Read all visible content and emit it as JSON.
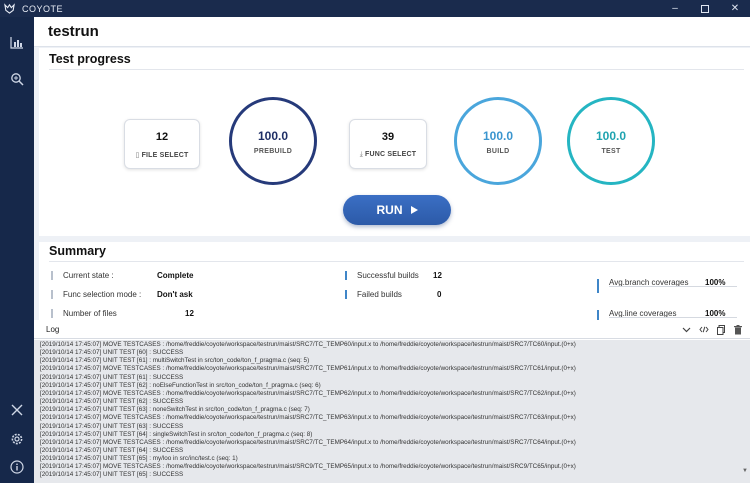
{
  "window": {
    "app_title": "COYOTE",
    "controls": [
      "minimize-icon",
      "maximize-icon",
      "close-icon"
    ]
  },
  "sidebar": {
    "icons": [
      "bar-chart-icon",
      "search-icon",
      "close-icon",
      "gear-icon",
      "info-icon"
    ]
  },
  "header": {
    "title": "testrun"
  },
  "progress": {
    "title": "Test progress",
    "file_select": {
      "value": "12",
      "label": "FILE SELECT",
      "icon": "file-icon"
    },
    "prebuild": {
      "value": "100.0",
      "label": "PREBUILD"
    },
    "func_select": {
      "value": "39",
      "label": "FUNC SELECT",
      "icon": "function-icon"
    },
    "build": {
      "value": "100.0",
      "label": "BUILD"
    },
    "test": {
      "value": "100.0",
      "label": "TEST"
    },
    "run_label": "RUN"
  },
  "colors": {
    "prebuild_ring": "#263a7a",
    "build_ring": "#4aa6dc",
    "test_ring": "#25b5c2",
    "run_button": "#2f5fb0",
    "sidebar": "#16284a"
  },
  "summary": {
    "title": "Summary",
    "current_state_label": "Current state :",
    "current_state_value": "Complete",
    "func_mode_label": "Func selection mode :",
    "func_mode_value": "Don't ask",
    "num_files_label": "Number of files",
    "num_files_value": "12",
    "successful_builds_label": "Successful builds",
    "successful_builds_value": "12",
    "failed_builds_label": "Failed builds",
    "failed_builds_value": "0",
    "avg_branch_label": "Avg.branch coverages",
    "avg_branch_value": "100%",
    "avg_line_label": "Avg.line coverages",
    "avg_line_value": "100%"
  },
  "log": {
    "title": "Log",
    "tools": [
      "chevron-down-icon",
      "code-icon",
      "copy-icon",
      "trash-icon"
    ],
    "lines": [
      "[2019/10/14 17:45:07] MOVE TESTCASES : /home/freddie/coyote/workspace/testrun/maist/SRC7/TC_TEMP60/input.x to /home/freddie/coyote/workspace/testrun/maist/SRC7/TC60/input.(0+x)",
      "[2019/10/14 17:45:07] UNIT TEST [60] : SUCCESS",
      "[2019/10/14 17:45:07] UNIT TEST [61] : multiSwitchTest in src/ton_code/ton_f_pragma.c (seq: 5)",
      "[2019/10/14 17:45:07] MOVE TESTCASES : /home/freddie/coyote/workspace/testrun/maist/SRC7/TC_TEMP61/input.x to /home/freddie/coyote/workspace/testrun/maist/SRC7/TC61/input.(0+x)",
      "[2019/10/14 17:45:07] UNIT TEST [61] : SUCCESS",
      "[2019/10/14 17:45:07] UNIT TEST [62] : noElseFunctionTest in src/ton_code/ton_f_pragma.c (seq: 6)",
      "[2019/10/14 17:45:07] MOVE TESTCASES : /home/freddie/coyote/workspace/testrun/maist/SRC7/TC_TEMP62/input.x to /home/freddie/coyote/workspace/testrun/maist/SRC7/TC62/input.(0+x)",
      "[2019/10/14 17:45:07] UNIT TEST [62] : SUCCESS",
      "[2019/10/14 17:45:07] UNIT TEST [63] : noneSwitchTest in src/ton_code/ton_f_pragma.c (seq: 7)",
      "[2019/10/14 17:45:07] MOVE TESTCASES : /home/freddie/coyote/workspace/testrun/maist/SRC7/TC_TEMP63/input.x to /home/freddie/coyote/workspace/testrun/maist/SRC7/TC63/input.(0+x)",
      "[2019/10/14 17:45:07] UNIT TEST [63] : SUCCESS",
      "[2019/10/14 17:45:07] UNIT TEST [64] : singleSwitchTest in src/ton_code/ton_f_pragma.c (seq: 8)",
      "[2019/10/14 17:45:07] MOVE TESTCASES : /home/freddie/coyote/workspace/testrun/maist/SRC7/TC_TEMP64/input.x to /home/freddie/coyote/workspace/testrun/maist/SRC7/TC64/input.(0+x)",
      "[2019/10/14 17:45:07] UNIT TEST [64] : SUCCESS",
      "[2019/10/14 17:45:07] UNIT TEST [65] : my/loo in src/inc/test.c (seq: 1)",
      "[2019/10/14 17:45:07] MOVE TESTCASES : /home/freddie/coyote/workspace/testrun/maist/SRC9/TC_TEMP65/input.x to /home/freddie/coyote/workspace/testrun/maist/SRC9/TC65/input.(0+x)",
      "[2019/10/14 17:45:07] UNIT TEST [65] : SUCCESS"
    ]
  }
}
